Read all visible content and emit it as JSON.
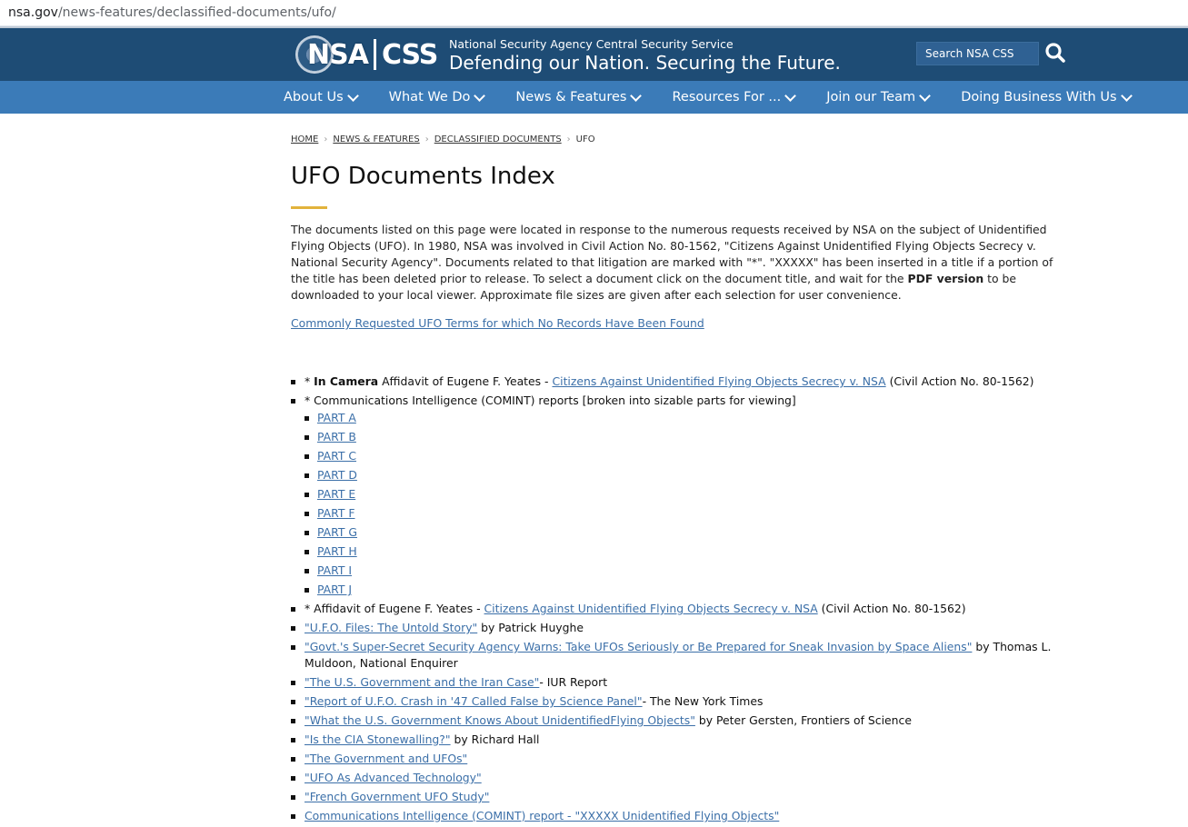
{
  "browser": {
    "url_domain": "nsa.gov",
    "url_path": "/news-features/declassified-documents/ufo/"
  },
  "header": {
    "logo_left": "NSA",
    "logo_right": "CSS",
    "agency_name": "National Security Agency Central Security Service",
    "tagline": "Defending our Nation. Securing the Future.",
    "search_placeholder": "Search NSA CSS"
  },
  "nav": {
    "items": [
      {
        "label": "About Us"
      },
      {
        "label": "What We Do"
      },
      {
        "label": "News & Features"
      },
      {
        "label": "Resources For ..."
      },
      {
        "label": "Join our Team"
      },
      {
        "label": "Doing Business With Us"
      }
    ]
  },
  "breadcrumb": {
    "home": "HOME",
    "news": "NEWS & FEATURES",
    "declassified": "DECLASSIFIED DOCUMENTS",
    "current": "UFO"
  },
  "page": {
    "title": "UFO Documents Index",
    "intro_1": "The documents listed on this page were located in response to the numerous requests received by NSA on the subject of Unidentified Flying Objects (UFO). In 1980, NSA was involved in Civil Action No. 80-1562, \"Citizens Against Unidentified Flying Objects Secrecy v. National Security Agency\". Documents related to that litigation are marked with \"*\". \"XXXXX\" has been inserted in a title if a portion of the title has been deleted prior to release. To select a document click on the document title, and wait for the ",
    "intro_bold": "PDF version",
    "intro_2": " to be downloaded to your local viewer. Approximate file sizes are given after each selection for user convenience.",
    "common_link": "Commonly Requested UFO Terms for which No Records Have Been Found"
  },
  "docs": {
    "item1": {
      "prefix": "* ",
      "bold": "In Camera",
      "text": " Affidavit of Eugene F. Yeates - ",
      "link": "Citizens Against Unidentified Flying Objects Secrecy v. NSA",
      "suffix": " (Civil Action No. 80-1562)"
    },
    "item2": {
      "text": "* Communications Intelligence (COMINT) reports [broken into sizable parts for viewing]"
    },
    "parts": [
      "PART A",
      "PART B",
      "PART C",
      "PART D",
      "PART E",
      "PART F",
      "PART G",
      "PART H",
      "PART I",
      "PART J"
    ],
    "item3": {
      "text": "* Affidavit of Eugene F. Yeates - ",
      "link": "Citizens Against Unidentified Flying Objects Secrecy v. NSA",
      "suffix": " (Civil Action No. 80-1562)"
    },
    "item4": {
      "link": "\"U.F.O. Files: The Untold Story\"",
      "suffix": " by Patrick Huyghe"
    },
    "item5": {
      "link": "\"Govt.'s Super-Secret Security Agency Warns: Take UFOs Seriously or Be Prepared for Sneak Invasion by Space Aliens\"",
      "suffix": " by Thomas L. Muldoon, National Enquirer"
    },
    "item6": {
      "link": "\"The U.S. Government and the Iran Case\"",
      "suffix": "- IUR Report"
    },
    "item7": {
      "link": "\"Report of U.F.O. Crash in '47 Called False by Science Panel\"",
      "suffix": "- The New York Times"
    },
    "item8": {
      "link": "\"What the U.S. Government Knows About UnidentifiedFlying Objects\"",
      "suffix": " by Peter Gersten, Frontiers of Science"
    },
    "item9": {
      "link": "\"Is the CIA Stonewalling?\"",
      "suffix": " by Richard Hall"
    },
    "item10": {
      "link": "\"The Government and UFOs\""
    },
    "item11": {
      "link": "\"UFO As Advanced Technology\""
    },
    "item12": {
      "link": "\"French Government UFO Study\""
    },
    "item13": {
      "link": "Communications Intelligence (COMINT) report - \"XXXXX Unidentified Flying Objects\""
    }
  }
}
